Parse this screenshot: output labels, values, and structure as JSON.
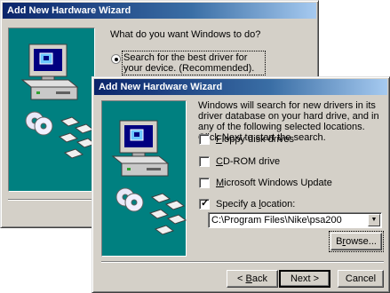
{
  "back_window": {
    "title": "Add New Hardware Wizard",
    "question": "What do you want Windows to do?",
    "option_best_driver": "Search for the best driver for your device. (Recommended)."
  },
  "front_window": {
    "title": "Add New Hardware Wizard",
    "description": "Windows will search for new drivers in its driver database on your hard drive, and in any of the following selected locations. Click Next to start the search.",
    "options": [
      {
        "hotkey": "F",
        "rest": "loppy disk drives",
        "checked": false
      },
      {
        "hotkey": "C",
        "rest": "D-ROM drive",
        "checked": false
      },
      {
        "hotkey": "M",
        "rest": "icrosoft Windows Update",
        "checked": false
      },
      {
        "prefix": "Specify a ",
        "hotkey": "l",
        "rest": "ocation:",
        "checked": true
      }
    ],
    "location_value": "C:\\Program Files\\Nike\\psa200",
    "browse": {
      "hotkey": "r",
      "prefix": "B",
      "rest": "owse..."
    },
    "back": {
      "arrow": "< ",
      "hotkey": "B",
      "rest": "ack"
    },
    "next_label": "Next >",
    "cancel_label": "Cancel"
  }
}
